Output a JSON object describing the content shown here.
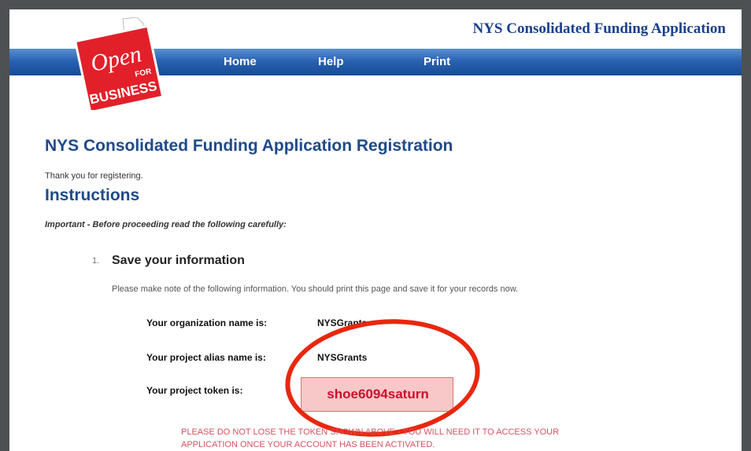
{
  "header": {
    "site_title": "NYS Consolidated Funding Application",
    "logo": {
      "word1": "Open",
      "word2": "FOR",
      "word3": "BUSINESS",
      "icon": "new-york-state-outline-icon"
    }
  },
  "nav": {
    "items": [
      "Home",
      "Help",
      "Print"
    ]
  },
  "main": {
    "page_title": "NYS Consolidated Funding Application Registration",
    "thank_you": "Thank you for registering.",
    "instructions_heading": "Instructions",
    "important_note": "Important - Before proceeding read the following carefully:",
    "step": {
      "number": "1.",
      "title": "Save your information",
      "description": "Please make note of the following information. You should print this page and save it for your records now."
    },
    "fields": [
      {
        "label": "Your organization name is:",
        "value": "NYSGrants"
      },
      {
        "label": "Your project alias name is:",
        "value": "NYSGrants"
      },
      {
        "label": "Your project token is:",
        "value": "shoe6094saturn"
      }
    ],
    "warning_line1": "PLEASE DO NOT LOSE THE TOKEN SHOWN ABOVE - YOU WILL NEED IT TO ACCESS YOUR",
    "warning_line2": "APPLICATION ONCE YOUR ACCOUNT HAS BEEN ACTIVATED."
  },
  "colors": {
    "nav_blue": "#164a97",
    "heading_blue": "#1e4a8a",
    "token_red": "#c8102e",
    "highlight_ring": "#e8270f"
  }
}
